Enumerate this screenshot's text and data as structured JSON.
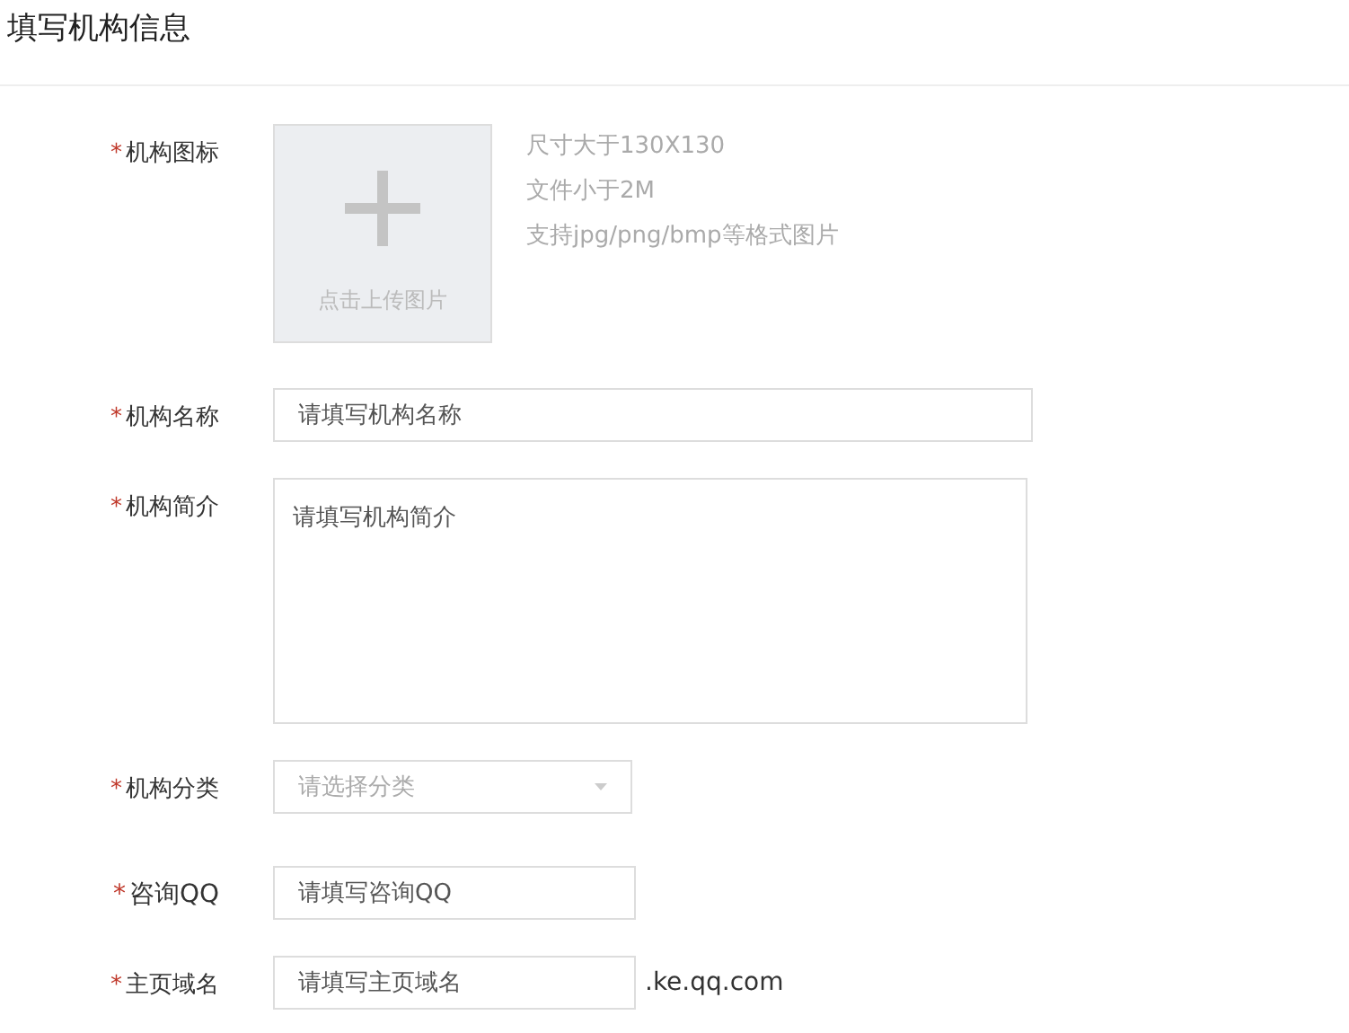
{
  "title": "填写机构信息",
  "fields": [
    {
      "kind": "upload",
      "label": "机构图标",
      "required_mark": "*",
      "button": "点击上传图片",
      "hints": [
        "尺寸大于130X130",
        "文件小于2M",
        "支持jpg/png/bmp等格式图片"
      ]
    },
    {
      "kind": "text",
      "label": "机构名称",
      "required_mark": "*",
      "placeholder": "请填写机构名称"
    },
    {
      "kind": "textarea",
      "label": "机构简介",
      "required_mark": "*",
      "placeholder": "请填写机构简介"
    },
    {
      "kind": "select",
      "label": "机构分类",
      "required_mark": "*",
      "placeholder": "请选择分类"
    },
    {
      "kind": "qq",
      "label": "咨询QQ",
      "required_mark": "*",
      "placeholder": "请填写咨询QQ"
    },
    {
      "kind": "domain",
      "label": "主页域名",
      "required_mark": "*",
      "placeholder": "请填写主页域名",
      "suffix": ".ke.qq.com"
    }
  ]
}
